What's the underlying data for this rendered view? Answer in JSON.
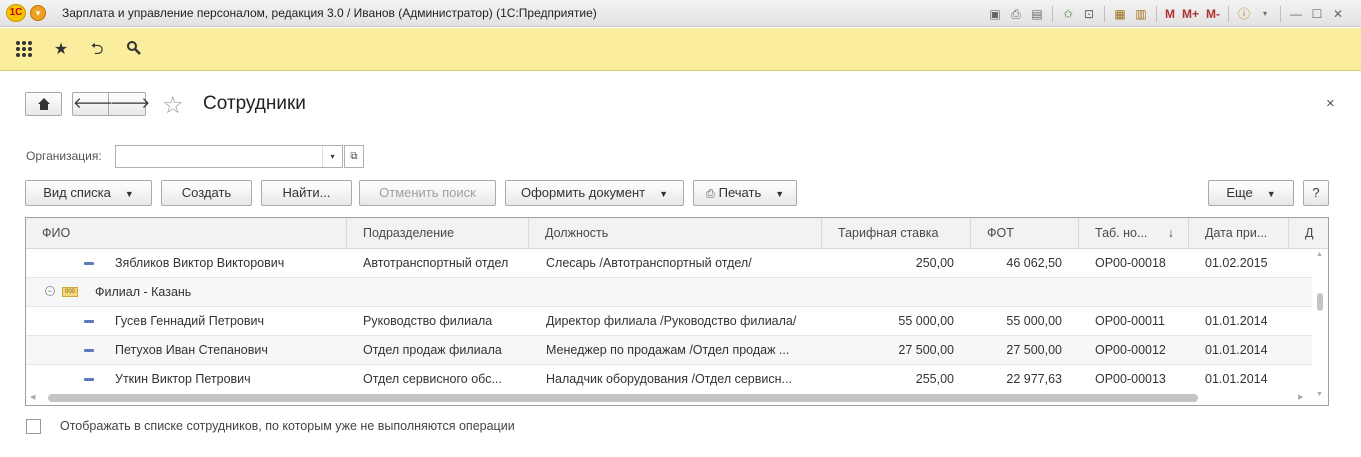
{
  "window": {
    "title": "Зарплата и управление персоналом, редакция 3.0 / Иванов (Администратор)  (1С:Предприятие)",
    "logo_text": "1С",
    "m_labels": [
      "M",
      "M+",
      "M-"
    ]
  },
  "page": {
    "title": "Сотрудники",
    "close": "×"
  },
  "filter": {
    "org_label": "Организация:",
    "org_value": ""
  },
  "toolbar": {
    "view_list": "Вид списка",
    "create": "Создать",
    "find": "Найти...",
    "cancel_search": "Отменить поиск",
    "make_document": "Оформить документ",
    "print": "Печать",
    "more": "Еще",
    "help": "?"
  },
  "table": {
    "columns": [
      "ФИО",
      "Подразделение",
      "Должность",
      "Тарифная ставка",
      "ФОТ",
      "Таб. но...",
      "Дата при...",
      "Д"
    ],
    "sort_indicator": "↓",
    "rows": [
      {
        "kind": "employee",
        "name": "Зябликов Виктор Викторович",
        "dept": "Автотранспортный отдел",
        "position": "Слесарь /Автотранспортный отдел/",
        "rate": "250,00",
        "fot": "46 062,50",
        "tab": "ОР00-00018",
        "date": "01.02.2015"
      },
      {
        "kind": "group",
        "name": "Филиал - Казань",
        "icon_text": "000"
      },
      {
        "kind": "employee",
        "name": "Гусев Геннадий Петрович",
        "dept": "Руководство филиала",
        "position": "Директор филиала /Руководство филиала/",
        "rate": "55 000,00",
        "fot": "55 000,00",
        "tab": "ОР00-00011",
        "date": "01.01.2014"
      },
      {
        "kind": "employee",
        "name": "Петухов Иван Степанович",
        "dept": "Отдел продаж филиала",
        "position": "Менеджер по продажам /Отдел продаж ...",
        "rate": "27 500,00",
        "fot": "27 500,00",
        "tab": "ОР00-00012",
        "date": "01.01.2014"
      },
      {
        "kind": "employee",
        "name": "Уткин Виктор Петрович",
        "dept": "Отдел сервисного обс...",
        "position": "Наладчик оборудования /Отдел сервисн...",
        "rate": "255,00",
        "fot": "22 977,63",
        "tab": "ОР00-00013",
        "date": "01.01.2014"
      }
    ]
  },
  "footer": {
    "checkbox_label": "Отображать в списке сотрудников, по которым уже не выполняются операции",
    "checked": false
  }
}
